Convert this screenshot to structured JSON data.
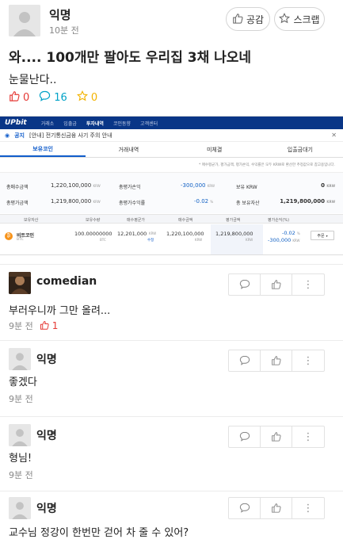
{
  "post": {
    "author": "익명",
    "time": "10분 전",
    "like_label": "공감",
    "scrap_label": "스크랩",
    "title": "와.... 100개만 팔아도 우리집 3채 나오네",
    "body": "눈물난다..",
    "likes": "0",
    "comments": "16",
    "scraps": "0"
  },
  "upbit": {
    "logo": "UPbit",
    "nav": [
      "거래소",
      "입출금",
      "투자내역",
      "코인동향",
      "고객센터"
    ],
    "nav_active": "투자내역",
    "notice_tag": "공지",
    "notice_text": "[안내] 전기통신금융 사기 주의 안내",
    "tabs": [
      "보유코인",
      "거래내역",
      "미체결",
      "입출금대기"
    ],
    "footnote": "* 매수평균가, 평가금액, 평가손익, 수익률은 모두 KRW로 환산한 추정값으로 참고용입니다.",
    "summary": [
      {
        "label": "총매수금액",
        "value": "1,220,100,000",
        "unit": "KRW"
      },
      {
        "label": "총평가손익",
        "value": "-300,000",
        "unit": "KRW"
      },
      {
        "label": "보유 KRW",
        "value": "0",
        "unit": "KRW"
      },
      {
        "label": "총평가금액",
        "value": "1,219,800,000",
        "unit": "KRW"
      },
      {
        "label": "총평가수익률",
        "value": "-0.02",
        "unit": "%"
      },
      {
        "label": "총 보유자산",
        "value": "1,219,800,000",
        "unit": "KRW"
      }
    ],
    "columns": [
      "보유자산",
      "보유수량",
      "매수평균가",
      "매수금액",
      "평가금액",
      "평가손익(%)"
    ],
    "row": {
      "name": "비트코인",
      "ticker": "BTC",
      "qty": "100.00000000",
      "qty_unit": "BTC",
      "avg": "12,201,000",
      "avg_unit": "KRW",
      "avg_edit": "수정",
      "buy": "1,220,100,000",
      "buy_unit": "KRW",
      "eval": "1,219,800,000",
      "eval_unit": "KRW",
      "pnl_pct": "-0.02",
      "pnl_pct_unit": "%",
      "pnl": "-300,000",
      "pnl_unit": "KRW",
      "order": "주문"
    }
  },
  "comments": [
    {
      "author": "comedian",
      "text": "부러우니까 그만 올려...",
      "time": "9분 전",
      "likes": "1"
    },
    {
      "author": "익명",
      "text": "좋겠다",
      "time": "9분 전"
    },
    {
      "author": "익명",
      "text": "형님!",
      "time": "9분 전"
    },
    {
      "author": "익명",
      "text": "교수님 정강이 한번만 걷어 차 줄 수 있어?"
    }
  ]
}
